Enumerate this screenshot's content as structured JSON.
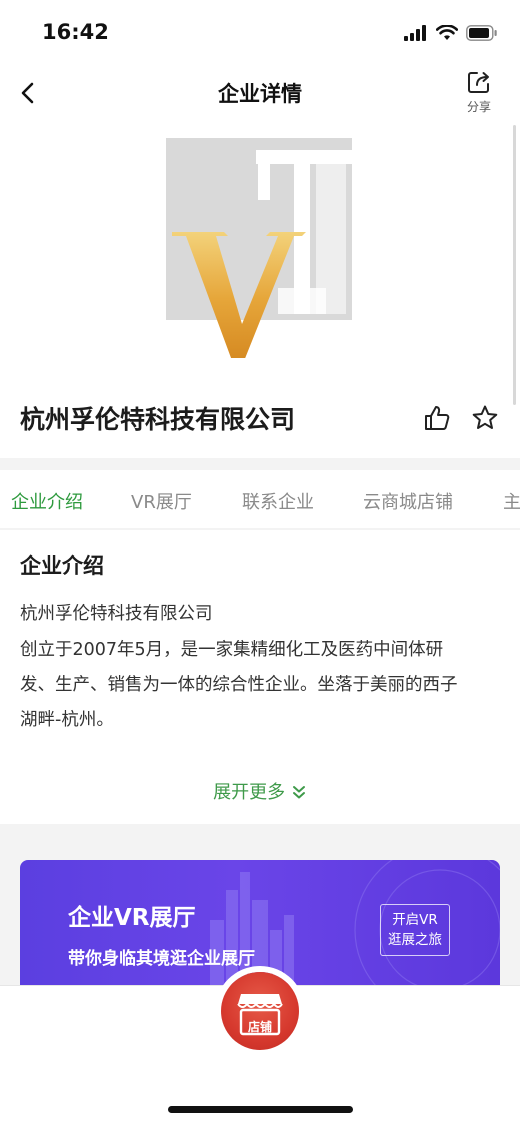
{
  "status_bar": {
    "time": "16:42"
  },
  "nav": {
    "title": "企业详情",
    "share_label": "分享"
  },
  "company": {
    "name": "杭州孚伦特科技有限公司",
    "logo_text": "VT"
  },
  "tabs": [
    {
      "label": "企业介绍",
      "active": true
    },
    {
      "label": "VR展厅",
      "active": false
    },
    {
      "label": "联系企业",
      "active": false
    },
    {
      "label": "云商城店铺",
      "active": false
    },
    {
      "label": "主",
      "active": false
    }
  ],
  "intro": {
    "heading": "企业介绍",
    "lines": [
      "杭州孚伦特科技有限公司",
      "创立于2007年5月，是一家集精细化工及医药中间体研",
      "发、生产、销售为一体的综合性企业。坐落于美丽的西子",
      "湖畔-杭州。"
    ],
    "expand_label": "展开更多"
  },
  "vr_banner": {
    "title": "企业VR展厅",
    "subtitle": "带你身临其境逛企业展厅",
    "button_line1": "开启VR",
    "button_line2": "逛展之旅"
  },
  "bottom": {
    "shop_label": "店铺"
  },
  "colors": {
    "accent_green": "#2e9a3e",
    "vr_purple": "#5b3fe0",
    "shop_red": "#d6392e",
    "logo_gold": "#e0a330"
  }
}
